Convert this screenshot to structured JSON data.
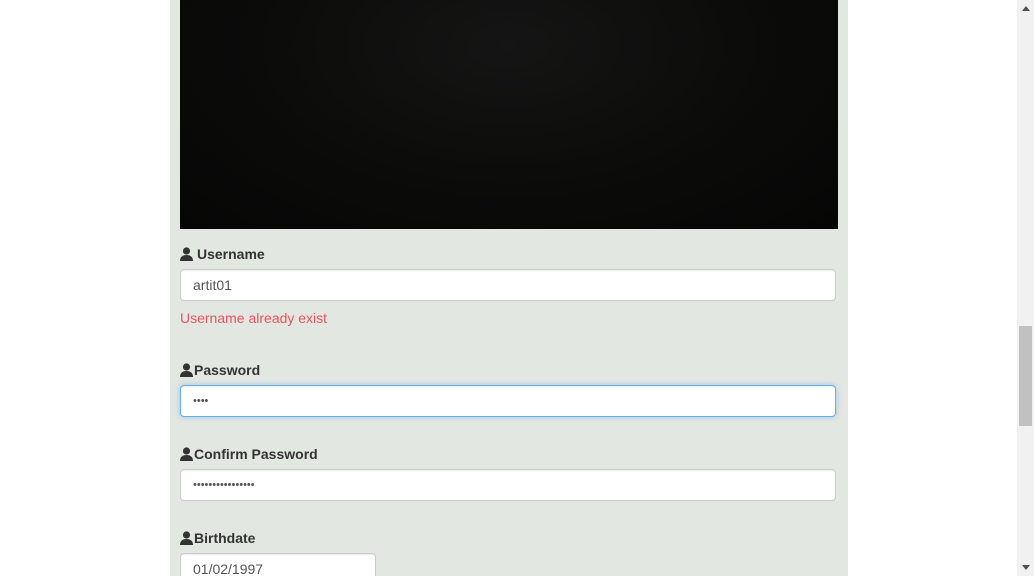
{
  "form": {
    "username": {
      "label": "Username",
      "value": "artit01",
      "error": "Username already exist"
    },
    "password": {
      "label": "Password",
      "value": "••••"
    },
    "confirm_password": {
      "label": "Confirm Password",
      "value": "••••••••••••••••"
    },
    "birthdate": {
      "label": "Birthdate",
      "value": "01/02/1997"
    }
  },
  "icons": {
    "field_icon": "user-icon",
    "scroll_up": "triangle-up",
    "scroll_down": "triangle-down"
  },
  "colors": {
    "panel_bg": "#e3e7e2",
    "error_text": "#e9535a",
    "focus_border": "#66afe9"
  }
}
